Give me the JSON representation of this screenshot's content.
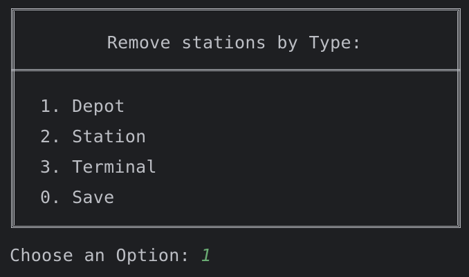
{
  "menu_box": {
    "title": "Remove stations by Type:",
    "items": [
      {
        "number": "1.",
        "label": "Depot"
      },
      {
        "number": "2.",
        "label": "Station"
      },
      {
        "number": "3.",
        "label": "Terminal"
      },
      {
        "number": "0.",
        "label": "Save"
      }
    ]
  },
  "prompt": {
    "label": "Choose an Option: ",
    "input_value": "1"
  },
  "colors": {
    "background": "#1e1f22",
    "text": "#bcbec4",
    "input": "#6aab73"
  }
}
